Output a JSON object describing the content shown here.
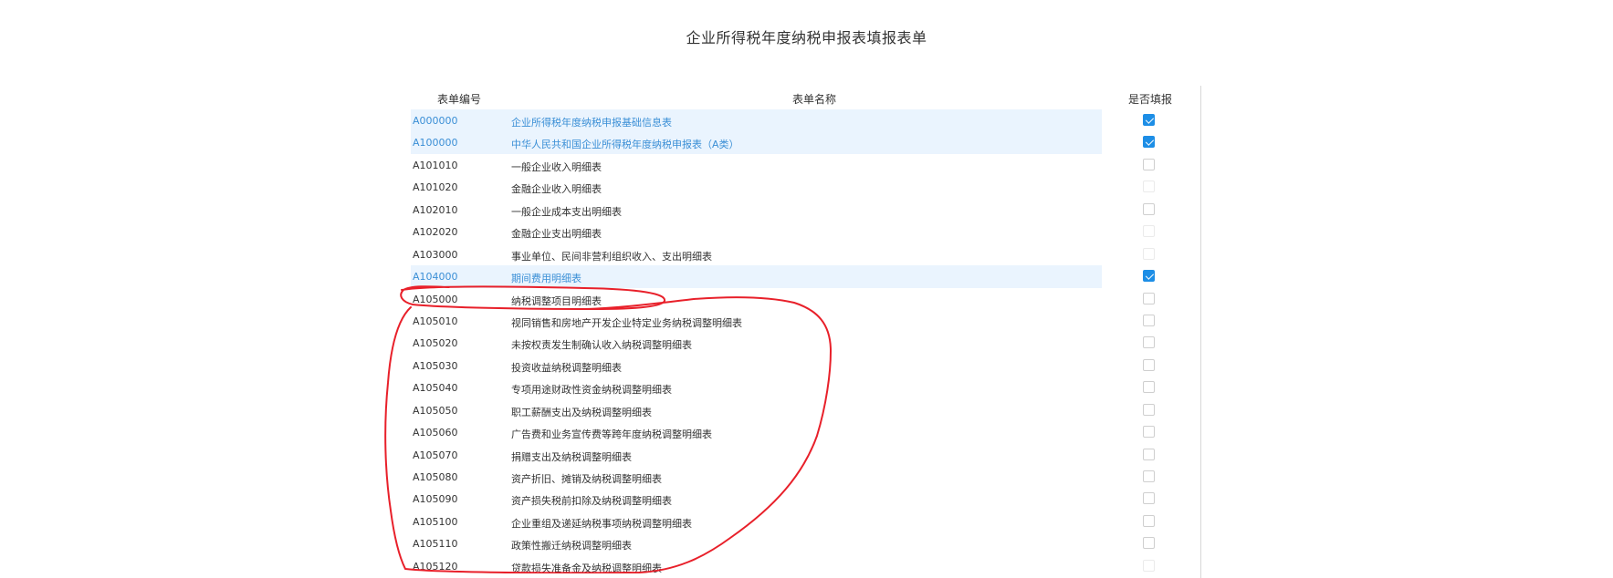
{
  "page": {
    "title": "企业所得税年度纳税申报表填报表单"
  },
  "table": {
    "headers": {
      "code": "表单编号",
      "name": "表单名称",
      "fill": "是否填报"
    },
    "rows": [
      {
        "code": "A000000",
        "name": "企业所得税年度纳税申报基础信息表",
        "checked": true,
        "enabled": true,
        "selected": true
      },
      {
        "code": "A100000",
        "name": "中华人民共和国企业所得税年度纳税申报表（A类）",
        "checked": true,
        "enabled": true,
        "selected": true
      },
      {
        "code": "A101010",
        "name": "一般企业收入明细表",
        "checked": false,
        "enabled": true,
        "selected": false
      },
      {
        "code": "A101020",
        "name": "金融企业收入明细表",
        "checked": false,
        "enabled": false,
        "selected": false
      },
      {
        "code": "A102010",
        "name": "一般企业成本支出明细表",
        "checked": false,
        "enabled": true,
        "selected": false
      },
      {
        "code": "A102020",
        "name": "金融企业支出明细表",
        "checked": false,
        "enabled": false,
        "selected": false
      },
      {
        "code": "A103000",
        "name": "事业单位、民间非营利组织收入、支出明细表",
        "checked": false,
        "enabled": false,
        "selected": false
      },
      {
        "code": "A104000",
        "name": "期间费用明细表",
        "checked": true,
        "enabled": true,
        "selected": true
      },
      {
        "code": "A105000",
        "name": "纳税调整项目明细表",
        "checked": false,
        "enabled": true,
        "selected": false
      },
      {
        "code": "A105010",
        "name": "视同销售和房地产开发企业特定业务纳税调整明细表",
        "checked": false,
        "enabled": true,
        "selected": false
      },
      {
        "code": "A105020",
        "name": "未按权责发生制确认收入纳税调整明细表",
        "checked": false,
        "enabled": true,
        "selected": false
      },
      {
        "code": "A105030",
        "name": "投资收益纳税调整明细表",
        "checked": false,
        "enabled": true,
        "selected": false
      },
      {
        "code": "A105040",
        "name": "专项用途财政性资金纳税调整明细表",
        "checked": false,
        "enabled": true,
        "selected": false
      },
      {
        "code": "A105050",
        "name": "职工薪酬支出及纳税调整明细表",
        "checked": false,
        "enabled": true,
        "selected": false
      },
      {
        "code": "A105060",
        "name": "广告费和业务宣传费等跨年度纳税调整明细表",
        "checked": false,
        "enabled": true,
        "selected": false
      },
      {
        "code": "A105070",
        "name": "捐赠支出及纳税调整明细表",
        "checked": false,
        "enabled": true,
        "selected": false
      },
      {
        "code": "A105080",
        "name": "资产折旧、摊销及纳税调整明细表",
        "checked": false,
        "enabled": true,
        "selected": false
      },
      {
        "code": "A105090",
        "name": "资产损失税前扣除及纳税调整明细表",
        "checked": false,
        "enabled": true,
        "selected": false
      },
      {
        "code": "A105100",
        "name": "企业重组及递延纳税事项纳税调整明细表",
        "checked": false,
        "enabled": true,
        "selected": false
      },
      {
        "code": "A105110",
        "name": "政策性搬迁纳税调整明细表",
        "checked": false,
        "enabled": true,
        "selected": false
      },
      {
        "code": "A105120",
        "name": "贷款损失准备金及纳税调整明细表",
        "checked": false,
        "enabled": false,
        "selected": false
      }
    ]
  },
  "colors": {
    "selected_row_bg": "#eaf4fe",
    "selected_text": "#3b8fd6",
    "checkbox_checked": "#1d8ee6",
    "annotation_stroke": "#e8202a"
  }
}
